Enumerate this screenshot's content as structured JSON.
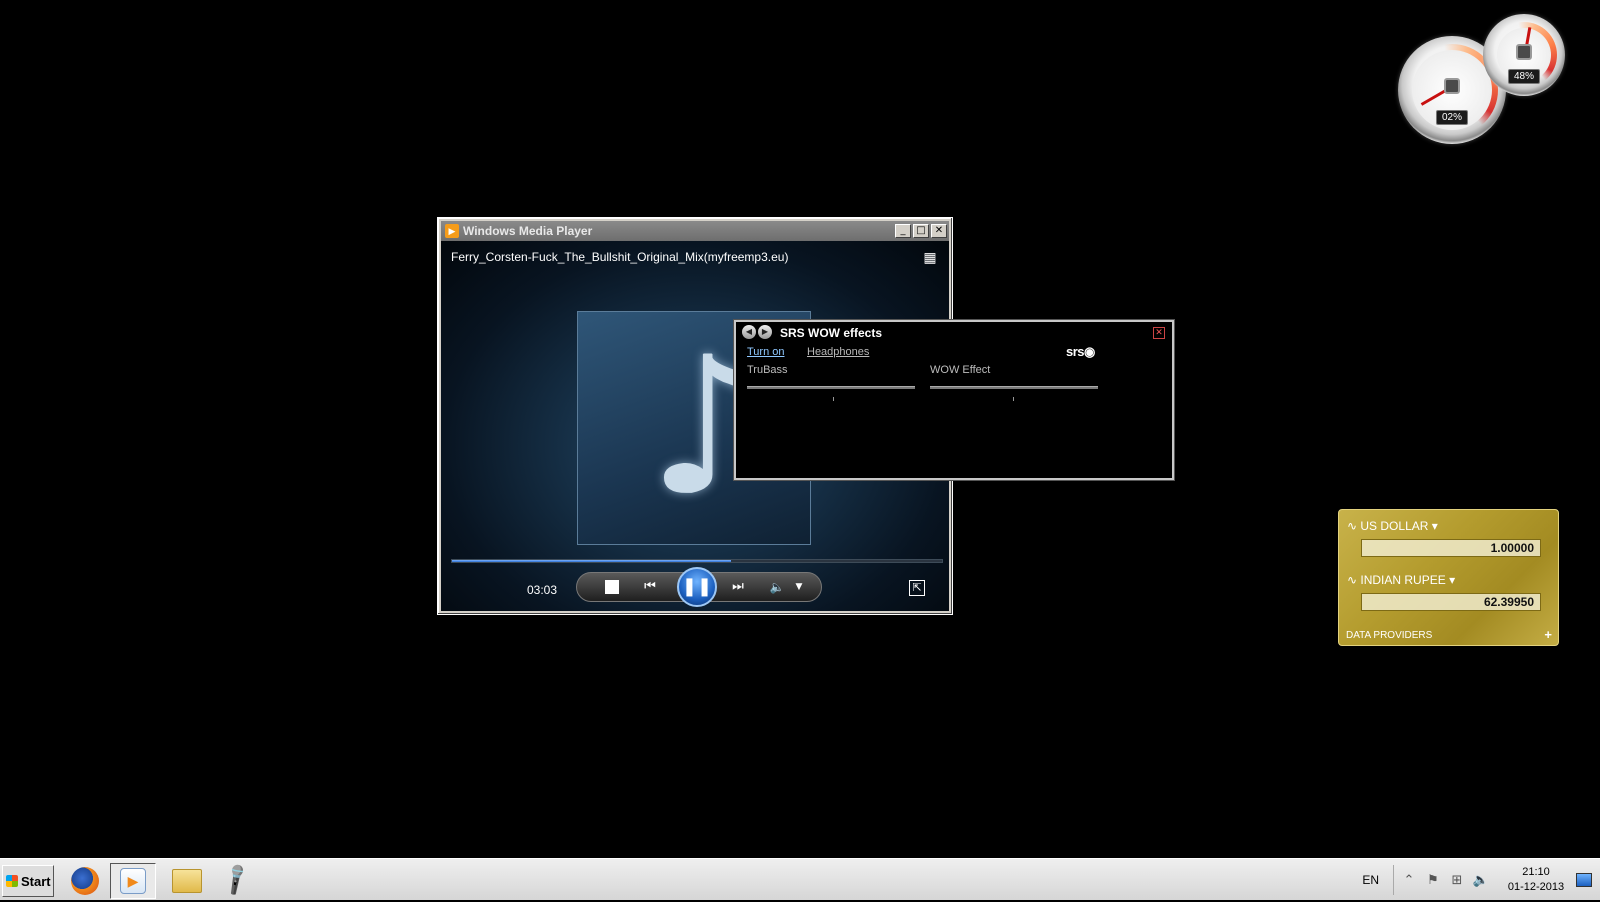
{
  "gadgets": {
    "cpu_meter": {
      "value": "02%"
    },
    "memory_meter": {
      "value": "48%"
    },
    "currency": {
      "from_currency": "US DOLLAR",
      "from_value": "1.00000",
      "to_currency": "INDIAN RUPEE",
      "to_value": "62.39950",
      "providers_label": "DATA PROVIDERS",
      "add_label": "+"
    }
  },
  "wmp": {
    "window_title": "Windows Media Player",
    "track_title": "Ferry_Corsten-Fuck_The_Bullshit_Original_Mix(myfreemp3.eu)",
    "elapsed_time": "03:03",
    "seek_progress": 0.57,
    "controls": {
      "minimize": "_",
      "maximize": "□",
      "close": "✕",
      "stop_icon": "stop-icon",
      "prev": "⏮",
      "play_pause": "❚❚",
      "next": "⏭",
      "volume": "🔈",
      "volume_dropdown": "▼",
      "switch_to_library": "▦",
      "fullscreen": "⇱"
    },
    "album_icon": "♪"
  },
  "srs": {
    "title": "SRS WOW effects",
    "turn_on_label": "Turn on",
    "headphones_label": "Headphones",
    "logo_text": "srs◉",
    "trubass_label": "TruBass",
    "wow_effect_label": "WOW Effect",
    "close_label": "✕",
    "nav_back": "◀",
    "nav_forward": "▶"
  },
  "taskbar": {
    "start_label": "Start",
    "language": "EN",
    "clock_time": "21:10",
    "clock_date": "01-12-2013",
    "tray_icons": [
      "⌃",
      "⚑",
      "⊞",
      "🔈"
    ]
  },
  "colors": {
    "accent": "#1b5fbf",
    "link": "#8fc8ff",
    "currency_gold": "#b49c2e"
  }
}
